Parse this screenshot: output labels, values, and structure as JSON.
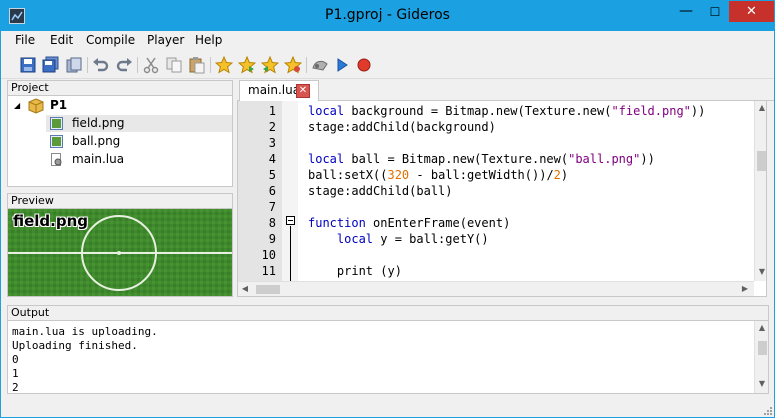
{
  "window": {
    "title": "P1.gproj - Gideros",
    "minimize": "—",
    "maximize": "☐",
    "close": "✕"
  },
  "menu": {
    "items": [
      {
        "label": "File"
      },
      {
        "label": "Edit"
      },
      {
        "label": "Compile"
      },
      {
        "label": "Player"
      },
      {
        "label": "Help"
      }
    ]
  },
  "toolbar": {
    "icons": [
      "save-icon",
      "save-all-icon",
      "copy-doc-icon",
      "undo-icon",
      "redo-icon",
      "cut-icon",
      "copy-icon",
      "paste-icon",
      "star-icon",
      "star-add-icon",
      "star-prev-icon",
      "star-next-icon",
      "player-icon",
      "play-icon",
      "stop-icon"
    ]
  },
  "project": {
    "header": "Project",
    "root": "P1",
    "files": [
      {
        "name": "field.png",
        "icon": "image-icon",
        "selected": true
      },
      {
        "name": "ball.png",
        "icon": "image-icon",
        "selected": false
      },
      {
        "name": "main.lua",
        "icon": "lua-file-icon",
        "selected": false
      }
    ]
  },
  "preview": {
    "header": "Preview",
    "label": "field.png"
  },
  "editor": {
    "tab": "main.lua",
    "tab_close": "✕",
    "line_numbers": [
      "1",
      "2",
      "3",
      "4",
      "5",
      "6",
      "7",
      "8",
      "9",
      "10",
      "11"
    ],
    "lines": [
      [
        {
          "t": "local",
          "c": "kw"
        },
        {
          "t": " background = Bitmap.new(Texture.new("
        },
        {
          "t": "\"field.png\"",
          "c": "str"
        },
        {
          "t": "))"
        }
      ],
      [
        {
          "t": "stage:addChild(background)"
        }
      ],
      [],
      [
        {
          "t": "local",
          "c": "kw"
        },
        {
          "t": " ball = Bitmap.new(Texture.new("
        },
        {
          "t": "\"ball.png\"",
          "c": "str"
        },
        {
          "t": "))"
        }
      ],
      [
        {
          "t": "ball:setX(("
        },
        {
          "t": "320",
          "c": "num"
        },
        {
          "t": " - ball:getWidth())/"
        },
        {
          "t": "2",
          "c": "num"
        },
        {
          "t": ")"
        }
      ],
      [
        {
          "t": "stage:addChild(ball)"
        }
      ],
      [],
      [
        {
          "t": "function",
          "c": "kw"
        },
        {
          "t": " onEnterFrame(event)"
        }
      ],
      [
        {
          "t": "    "
        },
        {
          "t": "local",
          "c": "kw"
        },
        {
          "t": " y = ball:getY()"
        }
      ],
      [],
      [
        {
          "t": "    print (y)"
        }
      ]
    ]
  },
  "output": {
    "header": "Output",
    "lines": [
      "main.lua is uploading.",
      "Uploading finished.",
      "0",
      "1",
      "2"
    ]
  },
  "colors": {
    "titlebar": "#1ba1e2",
    "close_button": "#c7312b",
    "keyword": "#0000c0",
    "string": "#800080",
    "number": "#e07000",
    "field_green": "#3f8a2e"
  }
}
